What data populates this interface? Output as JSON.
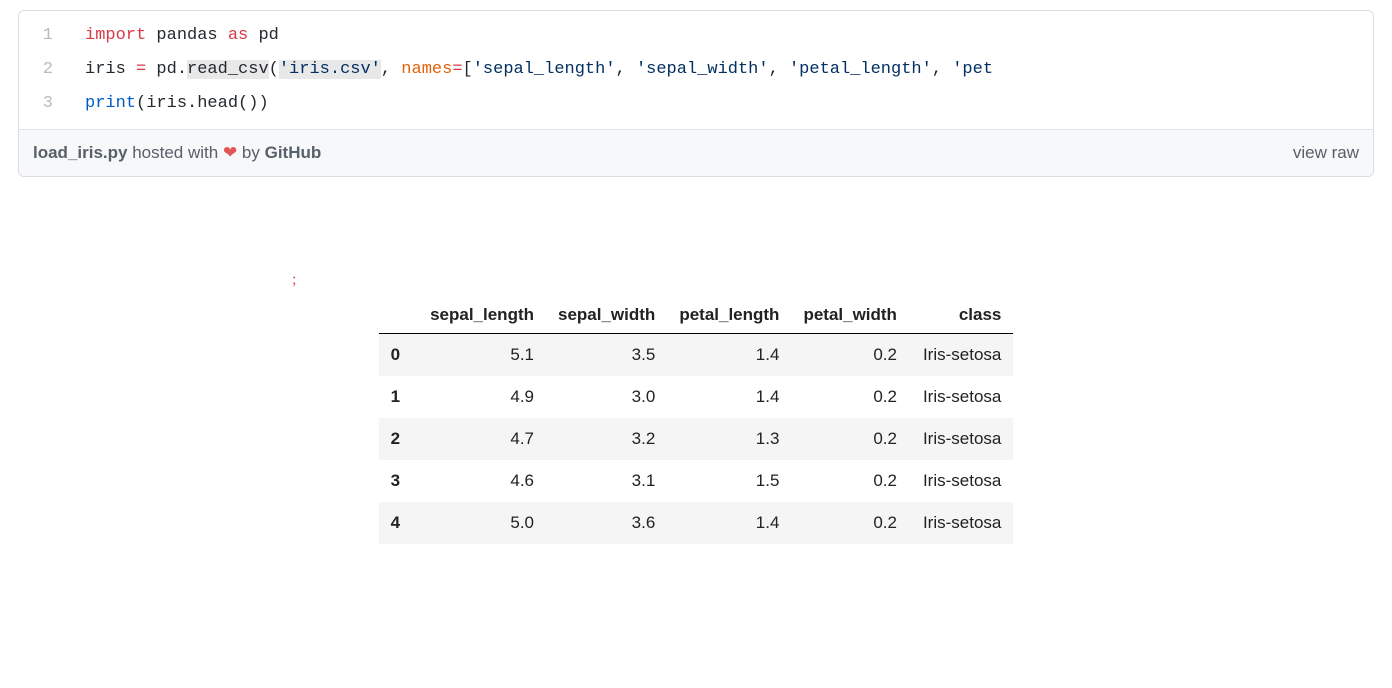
{
  "code": {
    "lines": [
      {
        "n": "1"
      },
      {
        "n": "2"
      },
      {
        "n": "3"
      }
    ],
    "tokens": {
      "l1": {
        "import": "import",
        "pandas": " pandas ",
        "as": "as",
        "pd": " pd"
      },
      "l2": {
        "iris_eq": "iris ",
        "eq": "=",
        "pd_dot": " pd",
        "dot": ".",
        "read_csv": "read_csv",
        "open": "(",
        "file": "'iris.csv'",
        "comma1": ", ",
        "names": "names",
        "eq2": "=",
        "bracket": "[",
        "s1": "'sepal_length'",
        "c1": ", ",
        "s2": "'sepal_width'",
        "c2": ", ",
        "s3": "'petal_length'",
        "c3": ", ",
        "s4": "'pet"
      },
      "l3": {
        "print": "print",
        "open": "(iris",
        "dot": ".",
        "head": "head",
        "close": "())"
      }
    }
  },
  "footer": {
    "filename": "load_iris.py",
    "hosted_with": " hosted with ",
    "heart": "❤",
    "by": " by ",
    "github": "GitHub",
    "view_raw": "view raw"
  },
  "stray": ";",
  "table": {
    "headers": [
      "",
      "sepal_length",
      "sepal_width",
      "petal_length",
      "petal_width",
      "class"
    ],
    "rows": [
      {
        "idx": "0",
        "c0": "5.1",
        "c1": "3.5",
        "c2": "1.4",
        "c3": "0.2",
        "c4": "Iris-setosa"
      },
      {
        "idx": "1",
        "c0": "4.9",
        "c1": "3.0",
        "c2": "1.4",
        "c3": "0.2",
        "c4": "Iris-setosa"
      },
      {
        "idx": "2",
        "c0": "4.7",
        "c1": "3.2",
        "c2": "1.3",
        "c3": "0.2",
        "c4": "Iris-setosa"
      },
      {
        "idx": "3",
        "c0": "4.6",
        "c1": "3.1",
        "c2": "1.5",
        "c3": "0.2",
        "c4": "Iris-setosa"
      },
      {
        "idx": "4",
        "c0": "5.0",
        "c1": "3.6",
        "c2": "1.4",
        "c3": "0.2",
        "c4": "Iris-setosa"
      }
    ]
  },
  "chart_data": {
    "type": "table",
    "title": "",
    "columns": [
      "sepal_length",
      "sepal_width",
      "petal_length",
      "petal_width",
      "class"
    ],
    "index": [
      0,
      1,
      2,
      3,
      4
    ],
    "data": [
      [
        5.1,
        3.5,
        1.4,
        0.2,
        "Iris-setosa"
      ],
      [
        4.9,
        3.0,
        1.4,
        0.2,
        "Iris-setosa"
      ],
      [
        4.7,
        3.2,
        1.3,
        0.2,
        "Iris-setosa"
      ],
      [
        4.6,
        3.1,
        1.5,
        0.2,
        "Iris-setosa"
      ],
      [
        5.0,
        3.6,
        1.4,
        0.2,
        "Iris-setosa"
      ]
    ]
  }
}
